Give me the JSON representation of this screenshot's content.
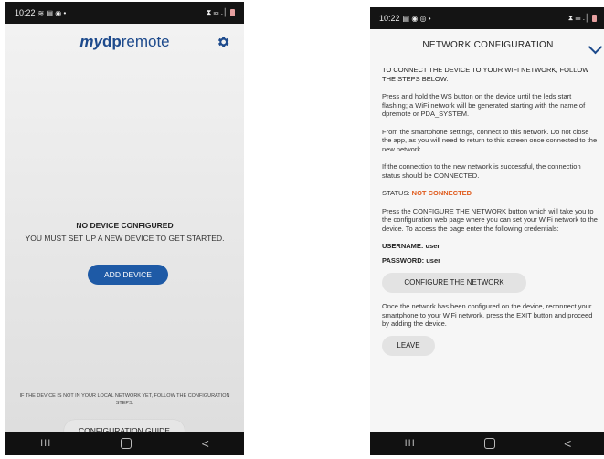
{
  "left_phone": {
    "status_bar": {
      "time": "10:22",
      "left_icons": "≋ ▤ ◉ •",
      "right_icons": "⧗ ☲ .│"
    },
    "logo": {
      "my": "my",
      "dp": "dp",
      "remote": "remote"
    },
    "settings_icon": "gear-icon",
    "no_device_title": "NO DEVICE CONFIGURED",
    "no_device_text": "YOU MUST SET UP A NEW DEVICE TO GET STARTED.",
    "add_device_label": "ADD DEVICE",
    "footnote": "IF THE DEVICE IS NOT IN YOUR LOCAL NETWORK YET, FOLLOW THE CONFIGURATION STEPS.",
    "configuration_guide_label": "CONFIGURATION GUIDE",
    "nav": {
      "recents": "III",
      "home": "",
      "back": "<"
    }
  },
  "right_phone": {
    "status_bar": {
      "time": "10:22",
      "left_icons": "▤ ◉ ◎ •",
      "right_icons": "⧗ ☲ .│"
    },
    "title": "NETWORK CONFIGURATION",
    "intro": "TO CONNECT THE DEVICE TO YOUR WIFI NETWORK, FOLLOW THE STEPS BELOW.",
    "step1": "Press and hold the WS button on the device until the leds start flashing; a WiFi network will be generated starting with the name of dpremote or PDA_SYSTEM.",
    "step2": "From the smartphone settings, connect to this network. Do not close the app, as you will need to return to this screen once connected to the new network.",
    "step3": "If the connection to the new network is successful, the connection status should be CONNECTED.",
    "status_label": "STATUS:",
    "status_value": "NOT CONNECTED",
    "step4": "Press the CONFIGURE THE NETWORK button which will take you to the configuration web page where you can set your WiFi network to the device. To access the page enter the following credentials:",
    "username_line": "USERNAME: user",
    "password_line": "PASSWORD: user",
    "configure_label": "CONFIGURE THE NETWORK",
    "step5": "Once the network has been configured on the device, reconnect your smartphone to your WiFi network, press the EXIT button and proceed by adding the device.",
    "leave_label": "LEAVE",
    "nav": {
      "recents": "III",
      "home": "",
      "back": "<"
    }
  },
  "colors": {
    "brand": "#1d4a8c",
    "button_blue": "#1e5aa6",
    "status_orange": "#e05a1c"
  }
}
